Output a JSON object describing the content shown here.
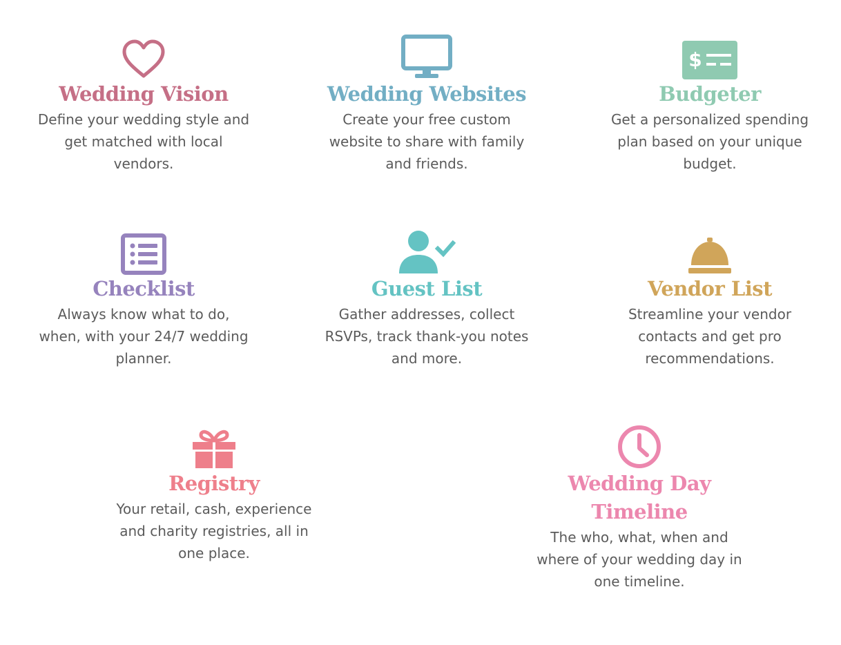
{
  "features": {
    "wedding_vision": {
      "title": "Wedding Vision",
      "description": "Define your wedding style and get matched with local vendors.",
      "color": "#c56f86",
      "icon": "heart-icon"
    },
    "wedding_websites": {
      "title": "Wedding Websites",
      "description": "Create your free custom website to share with family and friends.",
      "color": "#72aec4",
      "icon": "monitor-icon"
    },
    "budgeter": {
      "title": "Budgeter",
      "description": "Get a personalized spending plan based on your unique budget.",
      "color": "#8fcab1",
      "icon": "dollar-bill-icon"
    },
    "checklist": {
      "title": "Checklist",
      "description": "Always know what to do, when, with your 24/7 wedding planner.",
      "color": "#9683bd",
      "icon": "list-icon"
    },
    "guest_list": {
      "title": "Guest List",
      "description": "Gather addresses, collect RSVPs, track thank-you notes and more.",
      "color": "#64c3c3",
      "icon": "person-check-icon"
    },
    "vendor_list": {
      "title": "Vendor List",
      "description": "Streamline your vendor contacts and get pro recommendations.",
      "color": "#d0a55a",
      "icon": "service-bell-icon"
    },
    "registry": {
      "title": "Registry",
      "description": "Your retail, cash, experience and charity registries, all in one place.",
      "color": "#ee7f8b",
      "icon": "gift-icon"
    },
    "timeline": {
      "title": "Wedding Day Timeline",
      "description": "The who, what, when and where of your wedding day in one timeline.",
      "color": "#ec87ae",
      "icon": "clock-icon"
    }
  }
}
